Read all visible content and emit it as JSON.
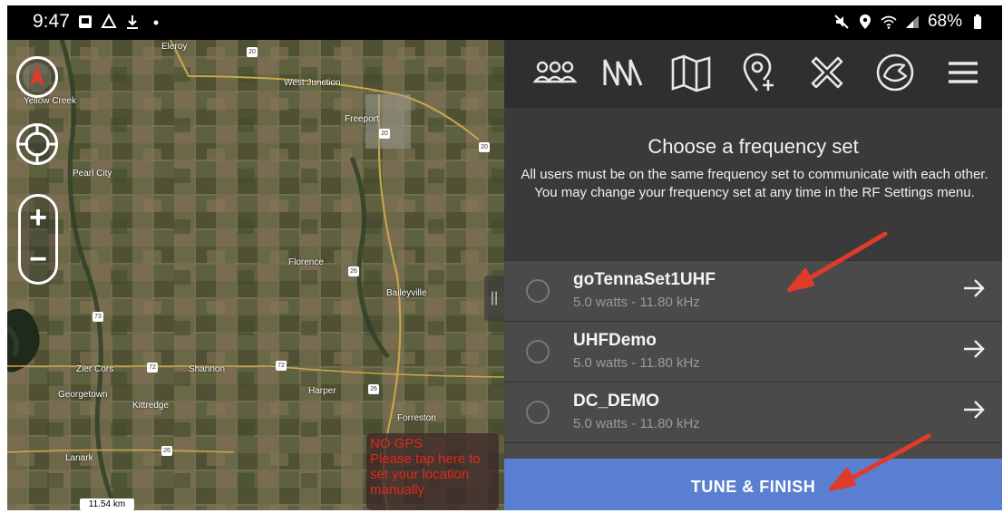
{
  "status_bar": {
    "time": "9:47",
    "battery": "68%",
    "icons_left": [
      "image-icon",
      "drive-icon",
      "download-icon",
      "dot-icon"
    ],
    "icons_right": [
      "mute-icon",
      "location-icon",
      "wifi-icon",
      "signal-icon",
      "battery-icon"
    ]
  },
  "map": {
    "places": [
      "Eleroy",
      "West Junction",
      "Yellow Creek",
      "Freeport",
      "Pearl City",
      "Florence",
      "Baileyville",
      "Zier Cors",
      "Shannon",
      "Georgetown",
      "Kittredge",
      "Harper",
      "Forreston",
      "Lanark"
    ],
    "route_shields": [
      "20",
      "20",
      "20",
      "26",
      "73",
      "72",
      "72",
      "26",
      "26"
    ],
    "no_gps_lines": [
      "NO GPS",
      "Please tap here to",
      "set your location",
      "manually"
    ],
    "scale_label": "11.54 km"
  },
  "toolbar": {
    "tools": [
      "team-icon",
      "network-icon",
      "map-icon",
      "add-location-icon",
      "cross-tool-icon",
      "power-icon",
      "menu-icon"
    ]
  },
  "dialog": {
    "title": "Choose a frequency set",
    "description": "All users must be on the same frequency set to communicate with each other. You may change your frequency set at any time in the RF Settings menu.",
    "frequency_sets": [
      {
        "name": "goTennaSet1UHF",
        "detail": "5.0 watts - 11.80 kHz"
      },
      {
        "name": "UHFDemo",
        "detail": "5.0 watts - 11.80 kHz"
      },
      {
        "name": "DC_DEMO",
        "detail": "5.0 watts - 11.80 kHz"
      }
    ],
    "button": "TUNE & FINISH"
  },
  "colors": {
    "accent": "#5b7fd0",
    "panel": "#3a3a3a",
    "row": "#4a4a4a",
    "annotation_arrow": "#e03b2a",
    "no_gps_text": "#e02a1a"
  }
}
